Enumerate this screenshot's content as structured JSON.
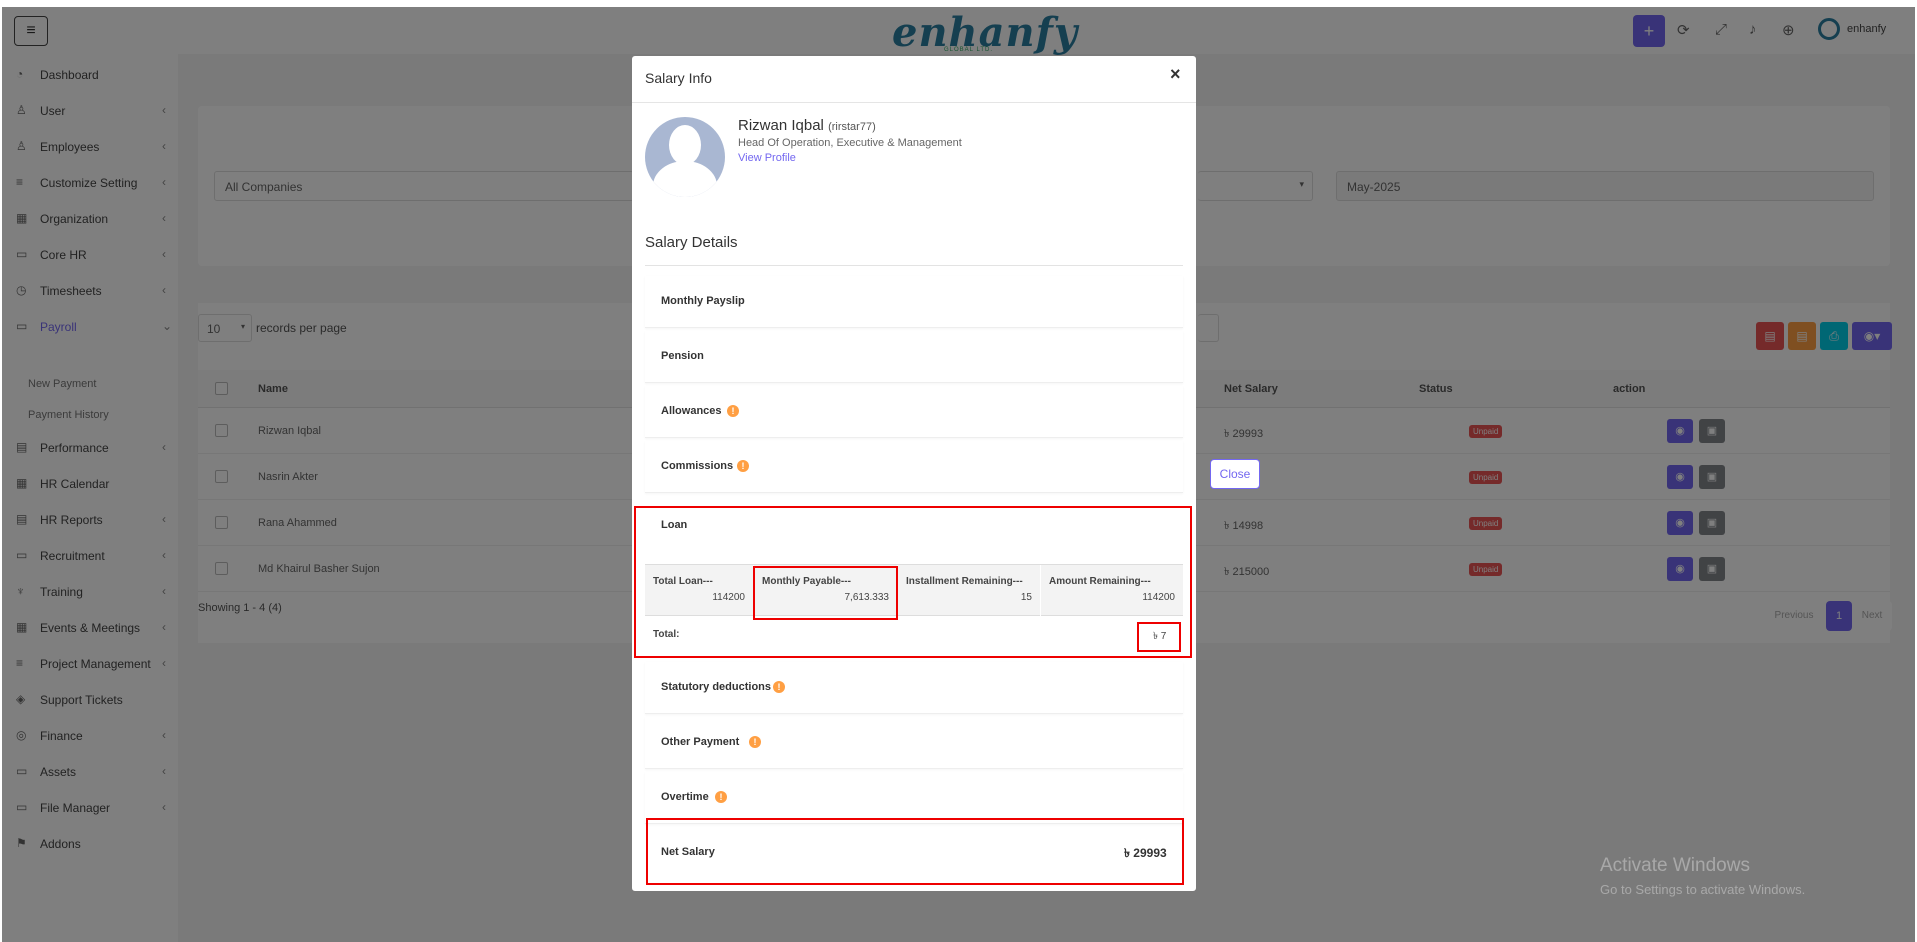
{
  "topbar": {
    "menu_icon": "≡",
    "logo": "enhanfy",
    "logo_sub": "GLOBAL LTD.",
    "user": "enhanfy"
  },
  "sidebar": {
    "items": [
      {
        "label": "Dashboard",
        "icon": "◔",
        "chevron": ""
      },
      {
        "label": "User",
        "icon": "♙",
        "chevron": "‹"
      },
      {
        "label": "Employees",
        "icon": "♙",
        "chevron": "‹"
      },
      {
        "label": "Customize Setting",
        "icon": "≡",
        "chevron": "‹"
      },
      {
        "label": "Organization",
        "icon": "▦",
        "chevron": "‹"
      },
      {
        "label": "Core HR",
        "icon": "▭",
        "chevron": "‹"
      },
      {
        "label": "Timesheets",
        "icon": "◷",
        "chevron": "‹"
      },
      {
        "label": "Payroll",
        "icon": "▭",
        "chevron": "⌄"
      }
    ],
    "payroll_sub": [
      "New Payment",
      "Payment History"
    ],
    "items2": [
      {
        "label": "Performance",
        "icon": "▤",
        "chevron": "‹"
      },
      {
        "label": "HR Calendar",
        "icon": "▦",
        "chevron": ""
      },
      {
        "label": "HR Reports",
        "icon": "▤",
        "chevron": "‹"
      },
      {
        "label": "Recruitment",
        "icon": "▭",
        "chevron": "‹"
      },
      {
        "label": "Training",
        "icon": "♆",
        "chevron": "‹"
      },
      {
        "label": "Events & Meetings",
        "icon": "▦",
        "chevron": "‹"
      },
      {
        "label": "Project Management",
        "icon": "≡",
        "chevron": "‹"
      },
      {
        "label": "Support Tickets",
        "icon": "◈",
        "chevron": ""
      },
      {
        "label": "Finance",
        "icon": "◎",
        "chevron": "‹"
      },
      {
        "label": "Assets",
        "icon": "▭",
        "chevron": "‹"
      },
      {
        "label": "File Manager",
        "icon": "▭",
        "chevron": "‹"
      },
      {
        "label": "Addons",
        "icon": "⚑",
        "chevron": ""
      }
    ]
  },
  "filters": {
    "company": "All Companies",
    "month": "May-2025"
  },
  "table": {
    "page_size": "10",
    "records_label": "records per page",
    "headers": {
      "name": "Name",
      "net_salary": "Net Salary",
      "status": "Status",
      "action": "action"
    },
    "rows": [
      {
        "name": "Rizwan Iqbal",
        "net": "৳ 29993",
        "status": "Unpaid"
      },
      {
        "name": "Nasrin Akter",
        "net": "",
        "status": "Unpaid"
      },
      {
        "name": "Rana Ahammed",
        "net": "৳ 14998",
        "status": "Unpaid"
      },
      {
        "name": "Md Khairul Basher Sujon",
        "net": "৳ 215000",
        "status": "Unpaid"
      }
    ],
    "showing": "Showing 1 - 4 (4)",
    "pagination": {
      "prev": "Previous",
      "page": "1",
      "next": "Next"
    }
  },
  "close_chip": "Close",
  "watermark": {
    "title": "Activate Windows",
    "sub": "Go to Settings to activate Windows."
  },
  "modal": {
    "title": "Salary Info",
    "close": "×",
    "employee": {
      "name": "Rizwan Iqbal",
      "username": "(rirstar77)",
      "role": "Head Of Operation, Executive & Management",
      "profile_link": "View Profile"
    },
    "details_title": "Salary Details",
    "sections": {
      "monthly_payslip": "Monthly Payslip",
      "pension": "Pension",
      "allowances": "Allowances",
      "commissions": "Commissions",
      "loan": "Loan",
      "statutory": "Statutory deductions",
      "other_payment": "Other Payment",
      "overtime": "Overtime"
    },
    "loan_table": [
      {
        "header": "Total Loan---",
        "value": "114200"
      },
      {
        "header": "Monthly Payable---",
        "value": "7,613.333"
      },
      {
        "header": "Installment Remaining---",
        "value": "15"
      },
      {
        "header": "Amount Remaining---",
        "value": "114200"
      }
    ],
    "loan_total_label": "Total:",
    "loan_total_value": "৳ 7",
    "net_salary_label": "Net Salary",
    "net_salary_value": "৳ 29993"
  },
  "colors": {
    "accent": "#7367f0",
    "highlight": "#e00000",
    "unpaid": "#ea5455",
    "info": "#ff9f43"
  }
}
